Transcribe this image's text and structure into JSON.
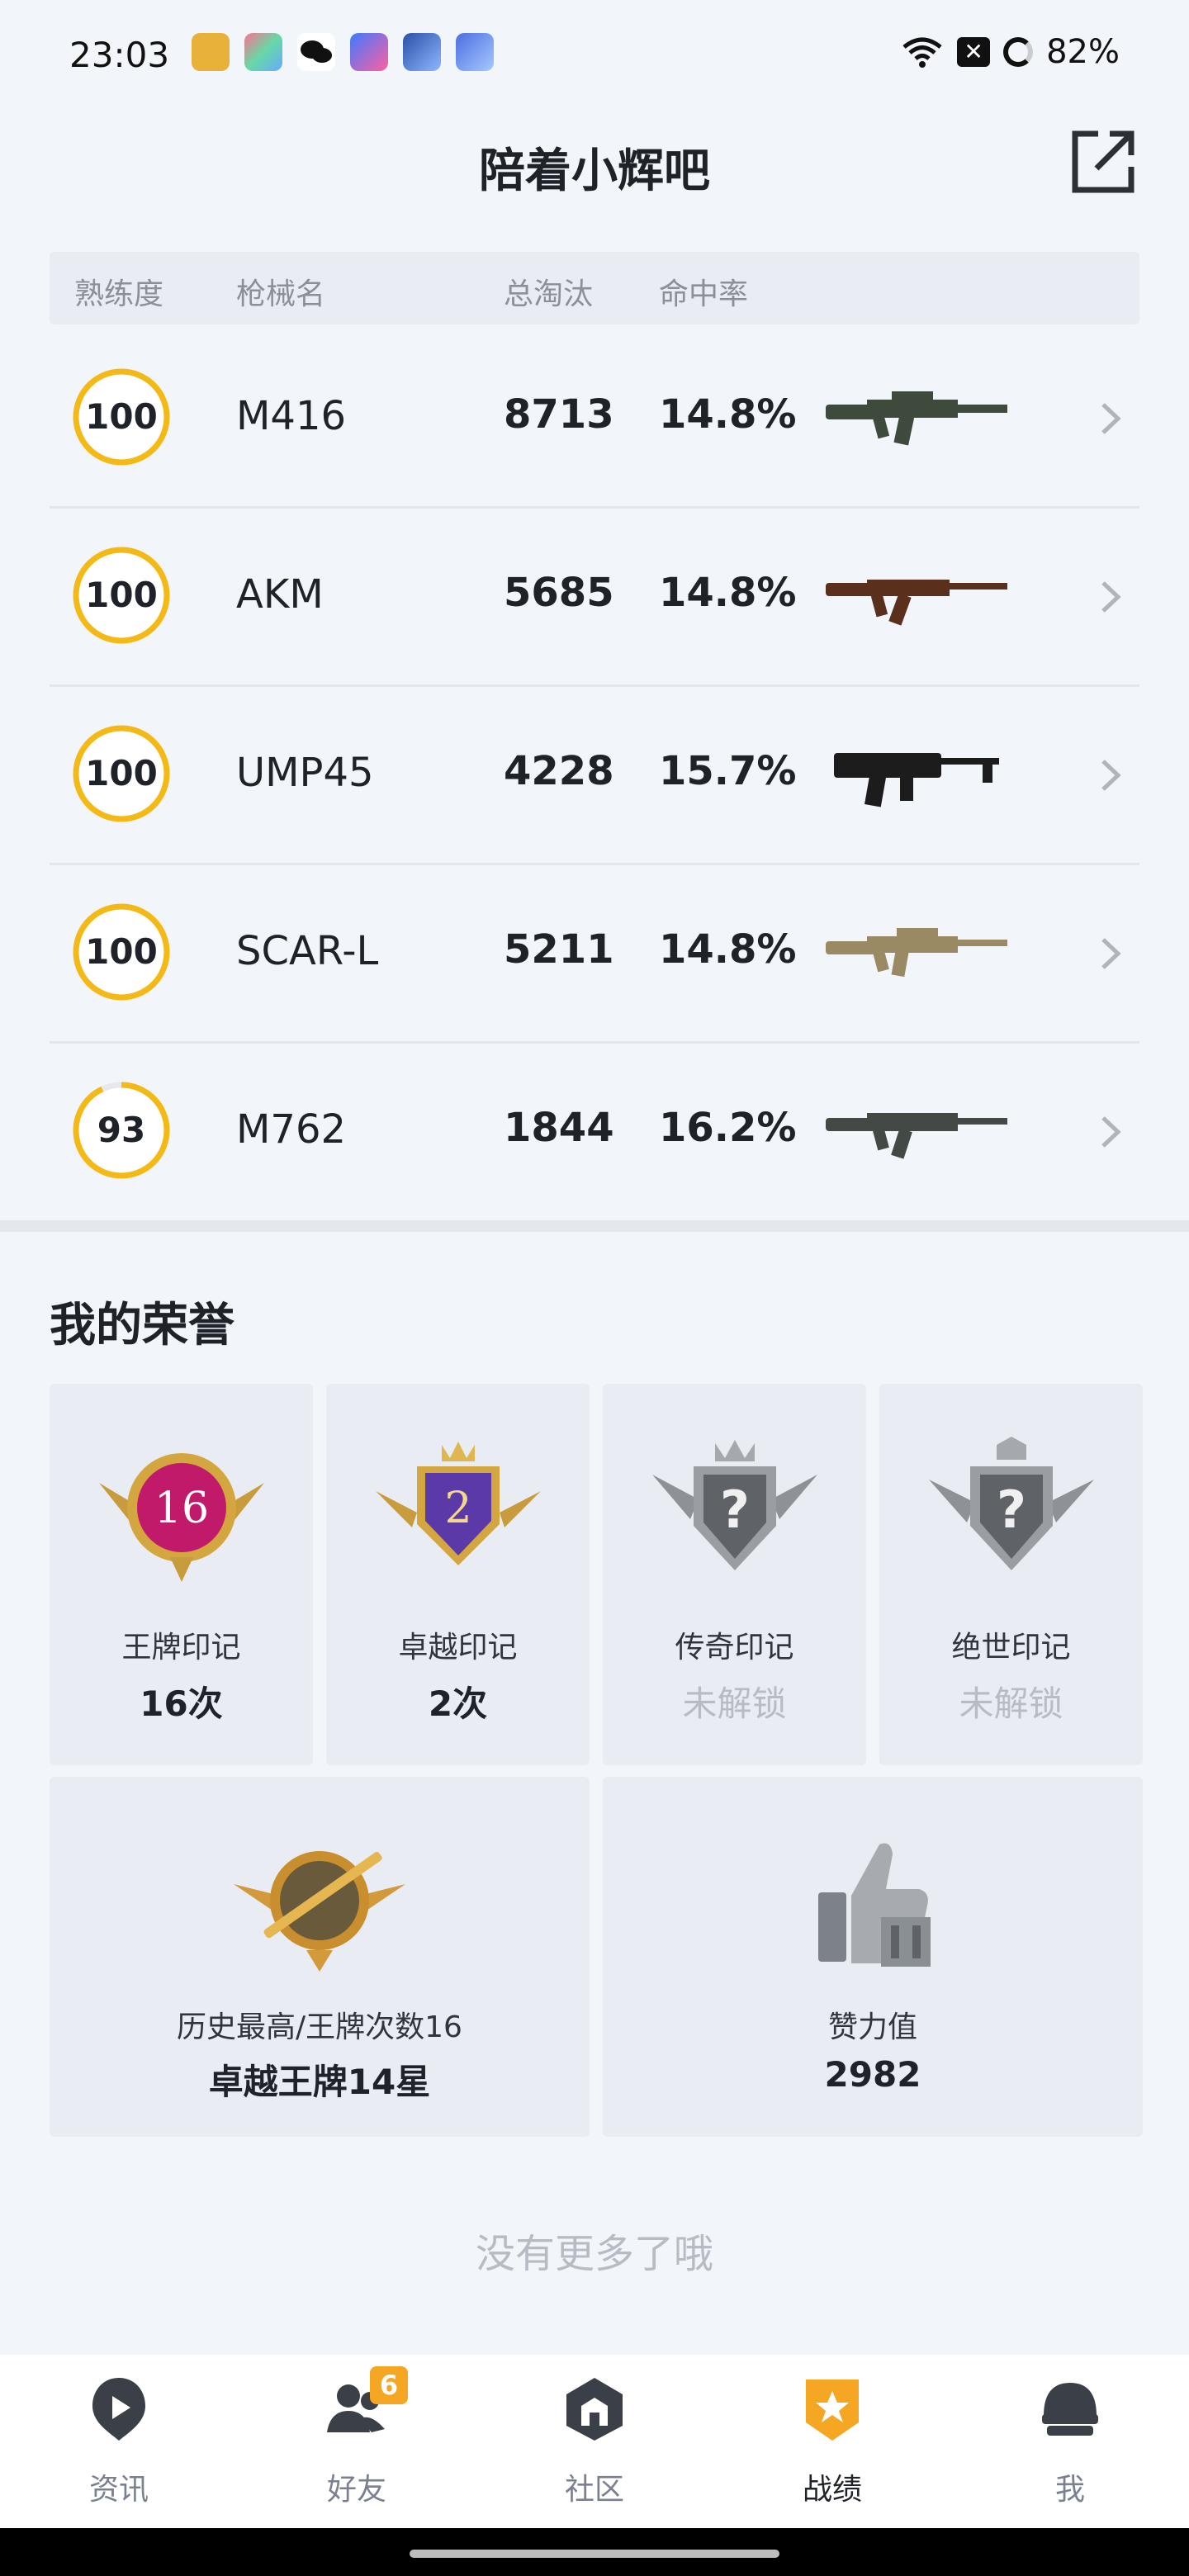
{
  "status_bar": {
    "time": "23:03",
    "battery": "82%"
  },
  "header": {
    "title": "陪着小辉吧"
  },
  "table": {
    "headers": {
      "proficiency": "熟练度",
      "weapon": "枪械名",
      "kills": "总淘汰",
      "accuracy": "命中率"
    },
    "rows": [
      {
        "proficiency": "100",
        "name": "M416",
        "kills": "8713",
        "accuracy": "14.8%",
        "progress": 1.0,
        "gun_color": "#3e4a3c"
      },
      {
        "proficiency": "100",
        "name": "AKM",
        "kills": "5685",
        "accuracy": "14.8%",
        "progress": 1.0,
        "gun_color": "#5a2f1c"
      },
      {
        "proficiency": "100",
        "name": "UMP45",
        "kills": "4228",
        "accuracy": "15.7%",
        "progress": 1.0,
        "gun_color": "#1c1c1c"
      },
      {
        "proficiency": "100",
        "name": "SCAR-L",
        "kills": "5211",
        "accuracy": "14.8%",
        "progress": 1.0,
        "gun_color": "#9a8a64"
      },
      {
        "proficiency": "93",
        "name": "M762",
        "kills": "1844",
        "accuracy": "16.2%",
        "progress": 0.93,
        "gun_color": "#434a45"
      }
    ]
  },
  "honors": {
    "title": "我的荣誉",
    "cards": [
      {
        "label": "王牌印记",
        "value": "16次",
        "locked": false,
        "emblem_text": "16"
      },
      {
        "label": "卓越印记",
        "value": "2次",
        "locked": false,
        "emblem_text": "2"
      },
      {
        "label": "传奇印记",
        "value": "未解锁",
        "locked": true,
        "emblem_text": "?"
      },
      {
        "label": "绝世印记",
        "value": "未解锁",
        "locked": true,
        "emblem_text": "?"
      }
    ],
    "stats": [
      {
        "label": "历史最高/王牌次数16",
        "value": "卓越王牌14星"
      },
      {
        "label": "赞力值",
        "value": "2982"
      }
    ]
  },
  "footer_note": "没有更多了哦",
  "tabs": [
    {
      "label": "资讯",
      "icon": "news-icon",
      "active": false
    },
    {
      "label": "好友",
      "icon": "friends-icon",
      "active": false,
      "badge": "6"
    },
    {
      "label": "社区",
      "icon": "community-icon",
      "active": false
    },
    {
      "label": "战绩",
      "icon": "record-icon",
      "active": true
    },
    {
      "label": "我",
      "icon": "profile-icon",
      "active": false
    }
  ],
  "colors": {
    "accent": "#f5a623",
    "ring": "#f5b915",
    "ring_track": "#e6e8ec"
  }
}
